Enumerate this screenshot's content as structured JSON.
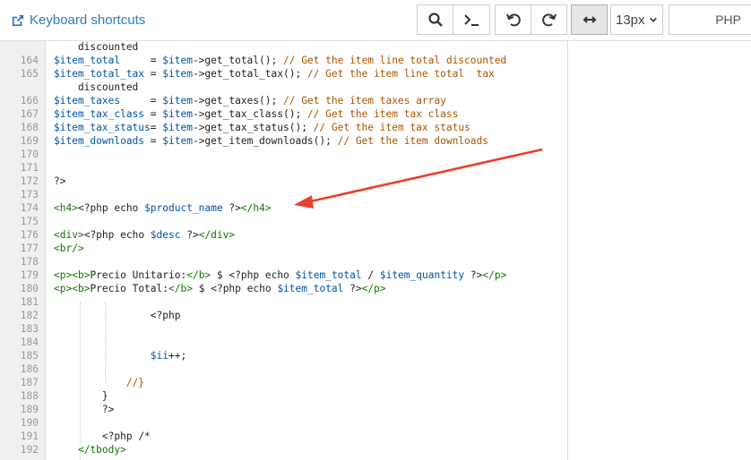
{
  "toolbar": {
    "keyboard_shortcuts": "Keyboard shortcuts",
    "font_size": "13px",
    "language": "PHP",
    "icons": [
      "external-link-icon",
      "search-icon",
      "terminal-icon",
      "undo-icon",
      "redo-icon",
      "wrap-arrows-icon",
      "chevron-down-icon"
    ]
  },
  "colors": {
    "link": "#337ab7",
    "variable": "#0055aa",
    "comment": "#aa5500",
    "tag": "#117700",
    "arrow": "#e8412c"
  },
  "code_lines": [
    {
      "n": "",
      "t": "    discounted"
    },
    {
      "n": "164",
      "t": "$item_total     = $item->get_total(); // Get the item line total discounted"
    },
    {
      "n": "165",
      "t": "$item_total_tax = $item->get_total_tax(); // Get the item line total  tax"
    },
    {
      "n": "",
      "t": "    discounted"
    },
    {
      "n": "166",
      "t": "$item_taxes     = $item->get_taxes(); // Get the item taxes array"
    },
    {
      "n": "167",
      "t": "$item_tax_class = $item->get_tax_class(); // Get the item tax class"
    },
    {
      "n": "168",
      "t": "$item_tax_status= $item->get_tax_status(); // Get the item tax status"
    },
    {
      "n": "169",
      "t": "$item_downloads = $item->get_item_downloads(); // Get the item downloads"
    },
    {
      "n": "170",
      "t": ""
    },
    {
      "n": "171",
      "t": ""
    },
    {
      "n": "172",
      "t": "?>"
    },
    {
      "n": "173",
      "t": ""
    },
    {
      "n": "174",
      "t": "<h4><?php echo $product_name ?></h4>"
    },
    {
      "n": "175",
      "t": ""
    },
    {
      "n": "176",
      "t": "<div><?php echo $desc ?></div>"
    },
    {
      "n": "177",
      "t": "<br/>"
    },
    {
      "n": "178",
      "t": ""
    },
    {
      "n": "179",
      "t": "<p><b>Precio Unitario:</b> $ <?php echo $item_total / $item_quantity ?></p>"
    },
    {
      "n": "180",
      "t": "<p><b>Precio Total:</b> $ <?php echo $item_total ?></p>"
    },
    {
      "n": "181",
      "t": ""
    },
    {
      "n": "182",
      "t": "                <?php"
    },
    {
      "n": "183",
      "t": ""
    },
    {
      "n": "184",
      "t": ""
    },
    {
      "n": "185",
      "t": "                $ii++;"
    },
    {
      "n": "186",
      "t": ""
    },
    {
      "n": "187",
      "t": "            //}"
    },
    {
      "n": "188",
      "t": "        }"
    },
    {
      "n": "189",
      "t": "        ?>"
    },
    {
      "n": "190",
      "t": ""
    },
    {
      "n": "191",
      "t": "        <?php /*"
    },
    {
      "n": "192",
      "t": "    </tbody>"
    }
  ]
}
